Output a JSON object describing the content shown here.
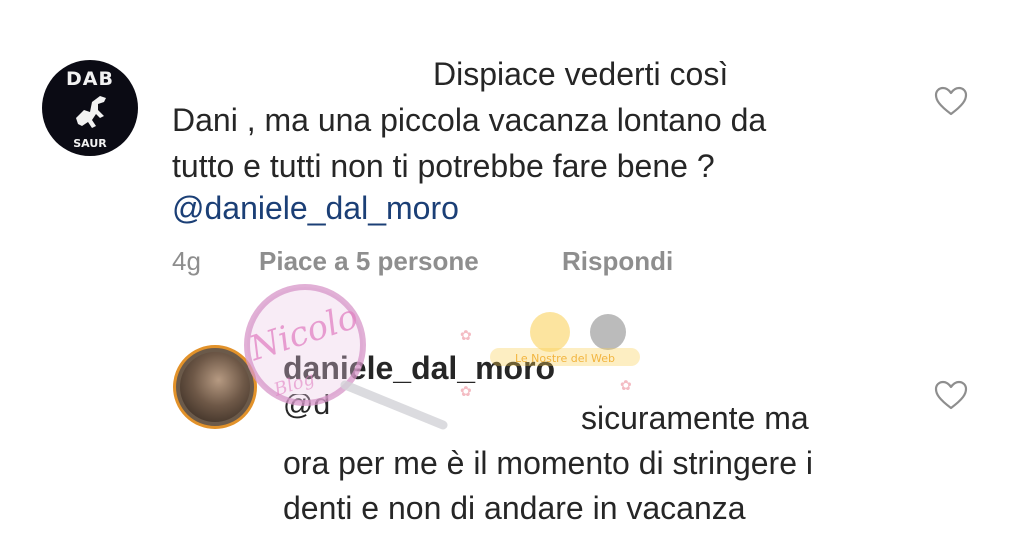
{
  "comment1": {
    "avatar_top": "DAB",
    "avatar_bottom": "SAUR",
    "line1": "Dispiace vederti così",
    "line2": "Dani , ma una piccola vacanza lontano da",
    "line3": "tutto e tutti non ti potrebbe fare  bene ?",
    "mention": "@daniele_dal_moro",
    "time": "4g",
    "likes": "Piace a 5 persone",
    "reply_label": "Rispondi",
    "like_icon": "heart-outline-icon"
  },
  "reply": {
    "username": "daniele_dal_moro",
    "partial_mention": "@d",
    "line1": "sicuramente ma",
    "line2": "ora per me è il momento di stringere i",
    "line3": "denti e non di andare in vacanza",
    "like_icon": "heart-outline-icon"
  },
  "watermark": {
    "text": "Nicolo",
    "sub": "Blog",
    "banner": "Le Nostre del Web"
  },
  "colors": {
    "text": "#262626",
    "mention": "#1b3f76",
    "meta": "#8e8e8e",
    "story_ring": "#e2922a"
  }
}
